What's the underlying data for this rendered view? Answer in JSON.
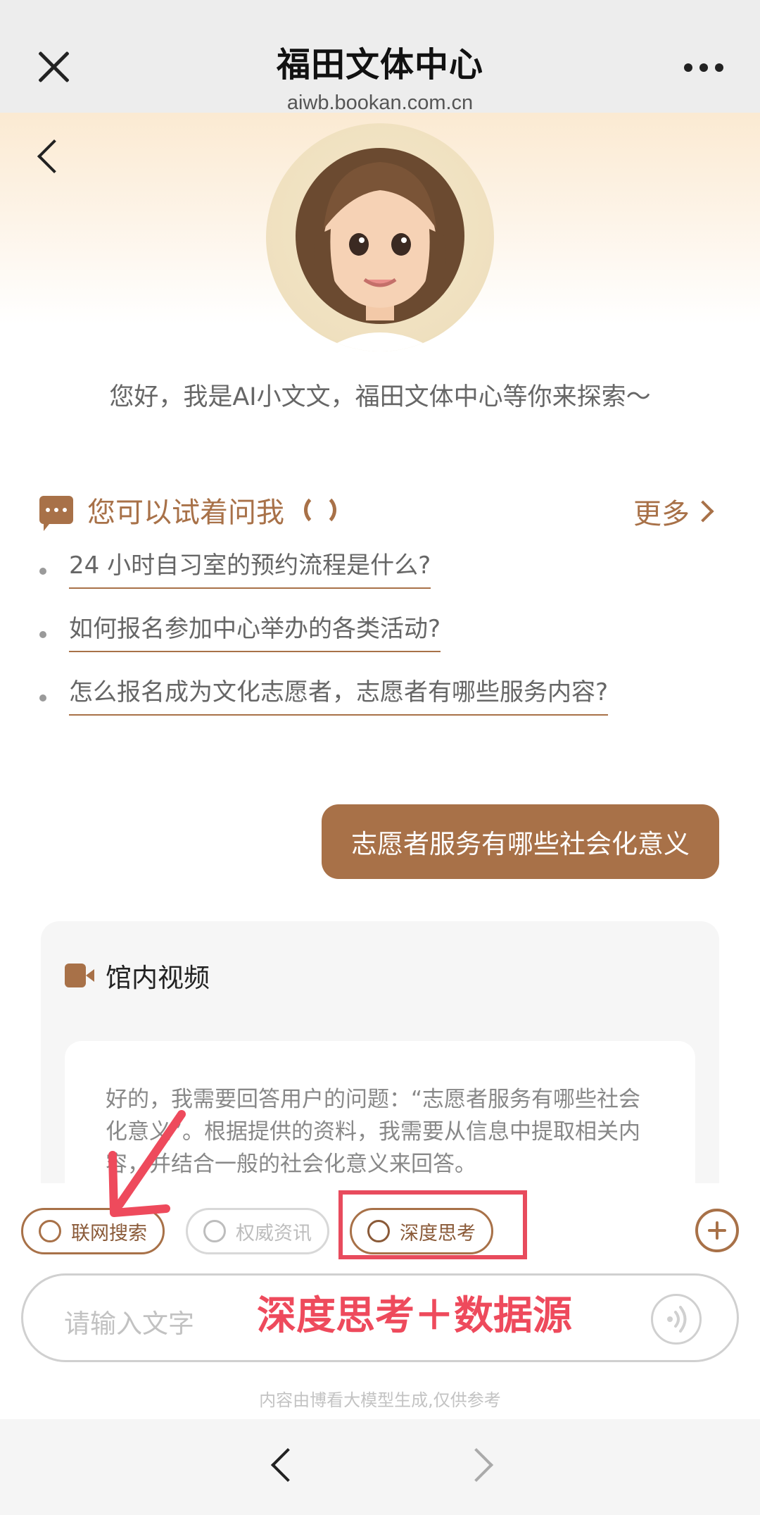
{
  "topbar": {
    "title": "福田文体中心",
    "subtitle": "aiwb.bookan.com.cn"
  },
  "greeting": "您好，我是AI小文文，福田文体中心等你来探索～",
  "suggestions": {
    "title": "您可以试着问我",
    "more": "更多",
    "items": [
      "24 小时自习室的预约流程是什么?",
      "如何报名参加中心举办的各类活动?",
      "怎么报名成为文化志愿者，志愿者有哪些服务内容?"
    ]
  },
  "user_message": "志愿者服务有哪些社会化意义",
  "response": {
    "section_title": "馆内视频",
    "thinking_text": "好的，我需要回答用户的问题：“志愿者服务有哪些社会化意义”。根据提供的资料，我需要从信息中提取相关内容，并结合一般的社会化意义来回答。"
  },
  "chips": {
    "web_search": "联网搜索",
    "authority_news": "权威资讯",
    "deep_think": "深度思考"
  },
  "annotation": "深度思考＋数据源",
  "input": {
    "placeholder": "请输入文字"
  },
  "disclaimer": "内容由博看大模型生成,仅供参考",
  "colors": {
    "accent": "#a87148",
    "annotation_red": "#e84b5d"
  }
}
